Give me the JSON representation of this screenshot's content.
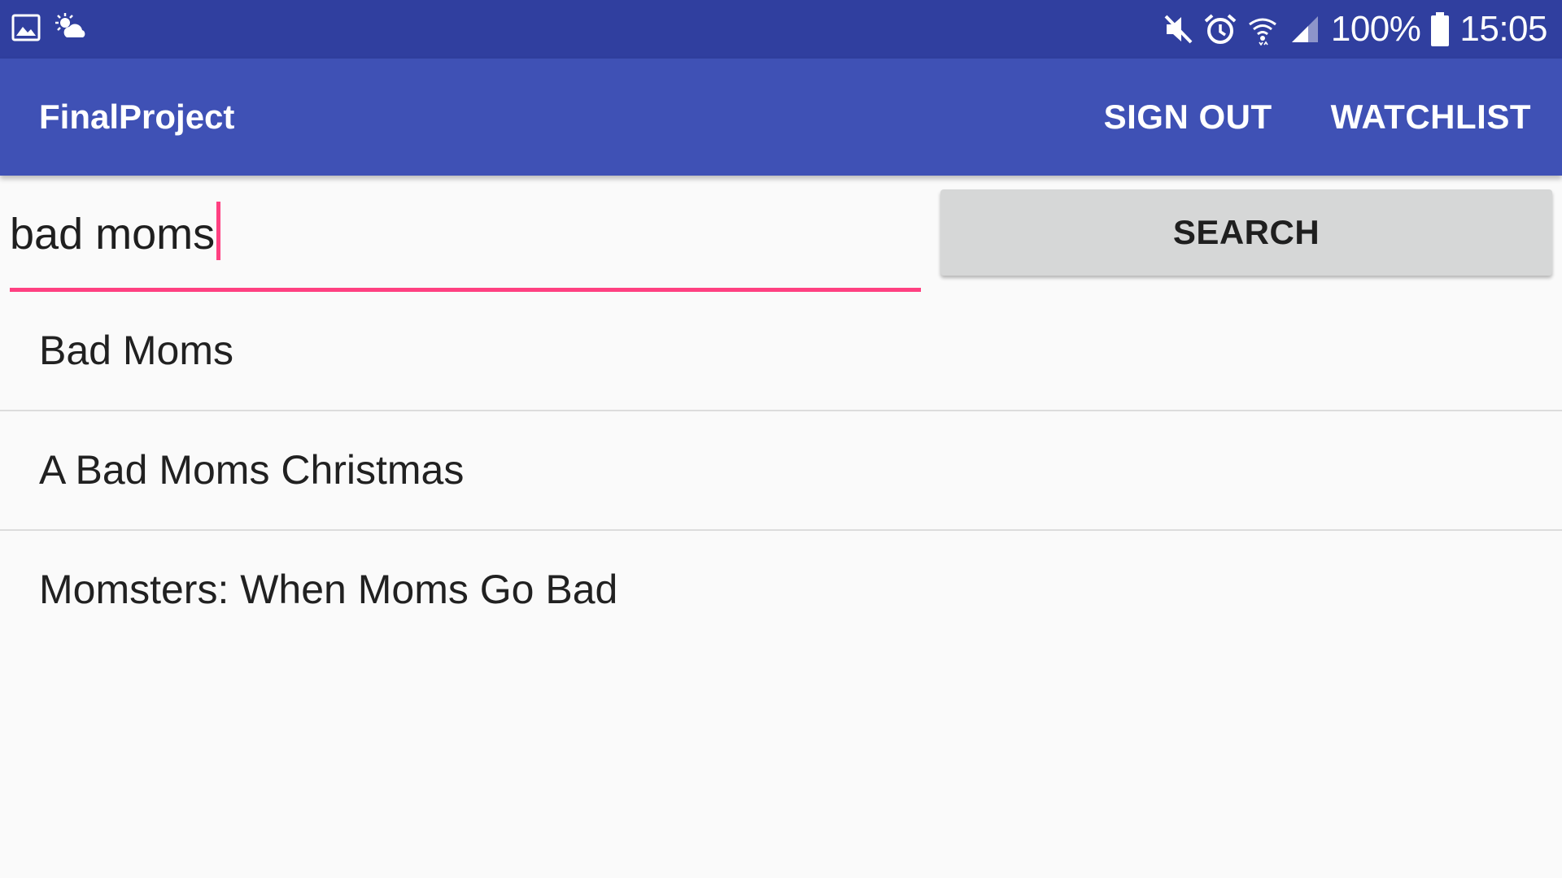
{
  "status_bar": {
    "icons_left": [
      "gallery-icon",
      "partly-cloudy-icon"
    ],
    "icons_right": [
      "muted-icon",
      "alarm-icon",
      "wifi-icon",
      "signal-icon"
    ],
    "battery": "100%",
    "time": "15:05"
  },
  "app_bar": {
    "title": "FinalProject",
    "actions": {
      "sign_out": "SIGN OUT",
      "watchlist": "WATCHLIST"
    }
  },
  "search": {
    "value": "bad moms",
    "button_label": "SEARCH"
  },
  "results": [
    {
      "title": "Bad Moms"
    },
    {
      "title": "A Bad Moms Christmas"
    },
    {
      "title": "Momsters: When Moms Go Bad"
    }
  ],
  "colors": {
    "status_bar": "#303f9f",
    "app_bar": "#3f51b5",
    "accent": "#ff4081",
    "button_bg": "#d6d7d7",
    "background": "#fafafa"
  }
}
